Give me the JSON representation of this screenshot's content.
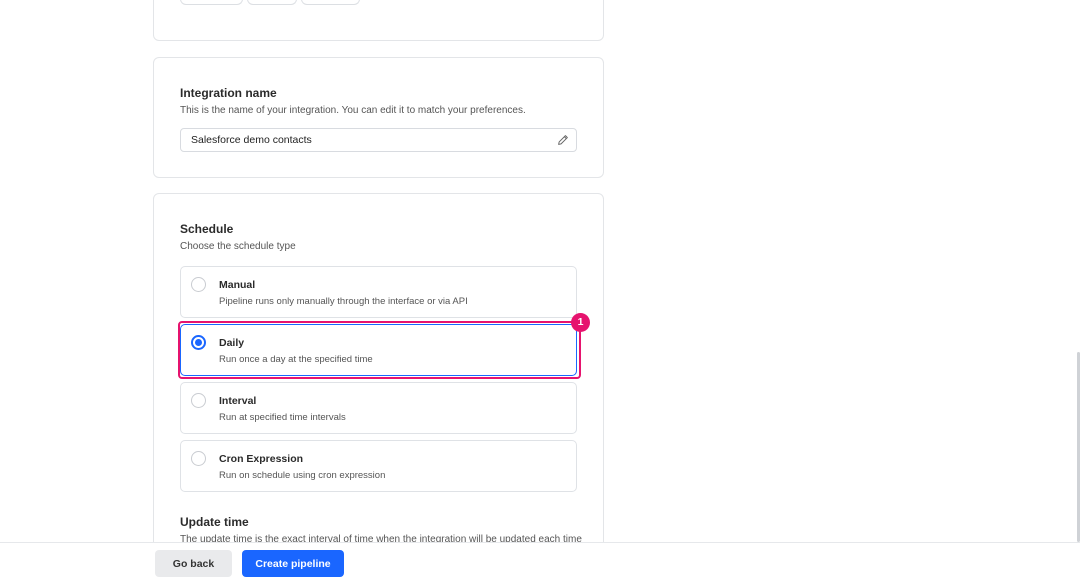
{
  "integration_name": {
    "title": "Integration name",
    "description": "This is the name of your integration. You can edit it to match your preferences.",
    "value": "Salesforce demo contacts"
  },
  "schedule": {
    "title": "Schedule",
    "description": "Choose the schedule type",
    "options": [
      {
        "label": "Manual",
        "description": "Pipeline runs only manually through the interface or via API",
        "selected": false
      },
      {
        "label": "Daily",
        "description": "Run once a day at the specified time",
        "selected": true
      },
      {
        "label": "Interval",
        "description": "Run at specified time intervals",
        "selected": false
      },
      {
        "label": "Cron Expression",
        "description": "Run on schedule using cron expression",
        "selected": false
      }
    ]
  },
  "update_time": {
    "title": "Update time",
    "description": "The update time is the exact interval of time when the integration will be updated each time"
  },
  "annotation": {
    "marker": "1"
  },
  "footer": {
    "back_label": "Go back",
    "create_label": "Create pipeline"
  },
  "colors": {
    "accent": "#1a66ff",
    "highlight": "#e6136e"
  },
  "icons": {
    "name_edit": "pencil-icon"
  }
}
